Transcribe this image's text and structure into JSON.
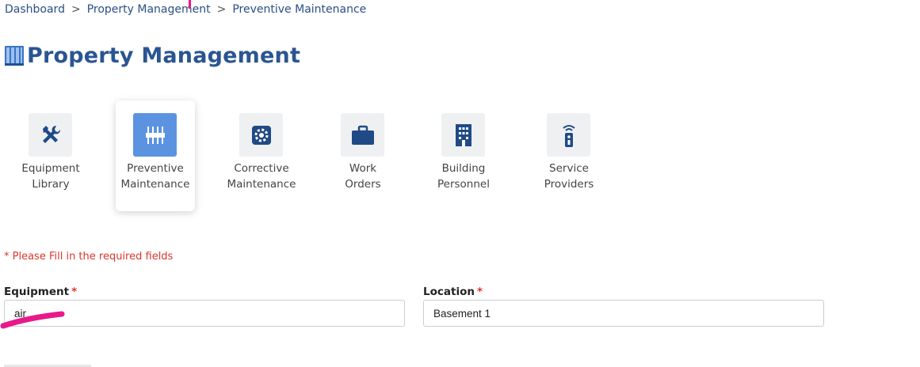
{
  "breadcrumb": {
    "items": [
      "Dashboard",
      "Property Management",
      "Preventive Maintenance"
    ],
    "separator": ">"
  },
  "page": {
    "title": "Property Management",
    "title_icon": "building-books-icon"
  },
  "modules": [
    {
      "line1": "Equipment",
      "line2": "Library",
      "icon": "tools-icon",
      "active": false
    },
    {
      "line1": "Preventive",
      "line2": "Maintenance",
      "icon": "sliders-icon",
      "active": true
    },
    {
      "line1": "Corrective",
      "line2": "Maintenance",
      "icon": "gear-icon",
      "active": false
    },
    {
      "line1": "Work",
      "line2": "Orders",
      "icon": "briefcase-icon",
      "active": false
    },
    {
      "line1": "Building",
      "line2": "Personnel",
      "icon": "building-icon",
      "active": false
    },
    {
      "line1": "Service",
      "line2": "Providers",
      "icon": "remote-icon",
      "active": false
    }
  ],
  "form": {
    "required_note": "* Please Fill in the required fields",
    "equipment": {
      "label": "Equipment",
      "required_mark": "*",
      "value": "air"
    },
    "location": {
      "label": "Location",
      "required_mark": "*",
      "value": "Basement 1"
    }
  },
  "colors": {
    "primary": "#2a5592",
    "active_tile": "#5b93e0",
    "required": "#e0342e",
    "annotation": "#e8198b"
  }
}
